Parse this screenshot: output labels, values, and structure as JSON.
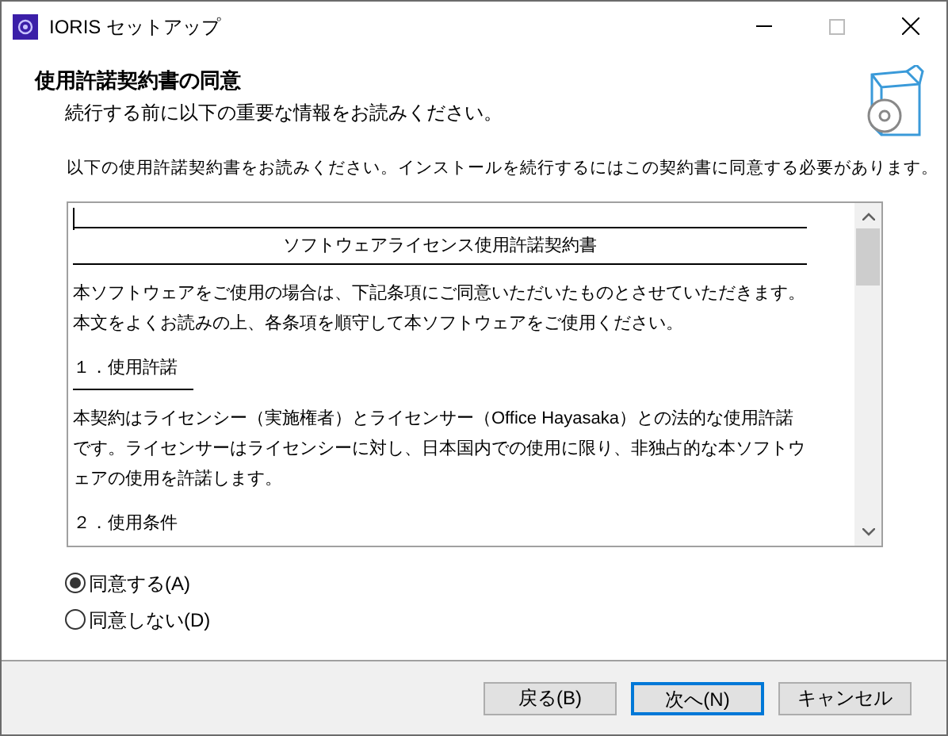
{
  "window": {
    "title": "IORIS セットアップ"
  },
  "header": {
    "title": "使用許諾契約書の同意",
    "subtitle": "続行する前に以下の重要な情報をお読みください。"
  },
  "instruction": "以下の使用許諾契約書をお読みください。インストールを続行するにはこの契約書に同意する必要があります。",
  "license": {
    "title": "ソフトウェアライセンス使用許諾契約書",
    "sections": [
      {
        "kind": "paragraph",
        "lines": [
          "本ソフトウェアをご使用の場合は、下記条項にご同意いただいたものとさせていただきます。",
          "本文をよくお読みの上、各条項を順守して本ソフトウェアをご使用ください。"
        ]
      },
      {
        "kind": "heading",
        "lines": [
          "１．使用許諾"
        ]
      },
      {
        "kind": "paragraph",
        "lines": [
          "本契約はライセンシー（実施権者）とライセンサー（Office Hayasaka）との法的な使用許諾",
          "です。ライセンサーはライセンシーに対し、日本国内での使用に限り、非独占的な本ソフトウ",
          "ェアの使用を許諾します。"
        ]
      },
      {
        "kind": "plain",
        "lines": [
          "２．使用条件"
        ]
      }
    ]
  },
  "options": [
    {
      "label": "同意する(A)",
      "selected": true
    },
    {
      "label": "同意しない(D)",
      "selected": false
    }
  ],
  "buttons": [
    {
      "label": "戻る(B)",
      "focused": false
    },
    {
      "label": "次へ(N)",
      "focused": true
    },
    {
      "label": "キャンセル",
      "focused": false
    }
  ]
}
